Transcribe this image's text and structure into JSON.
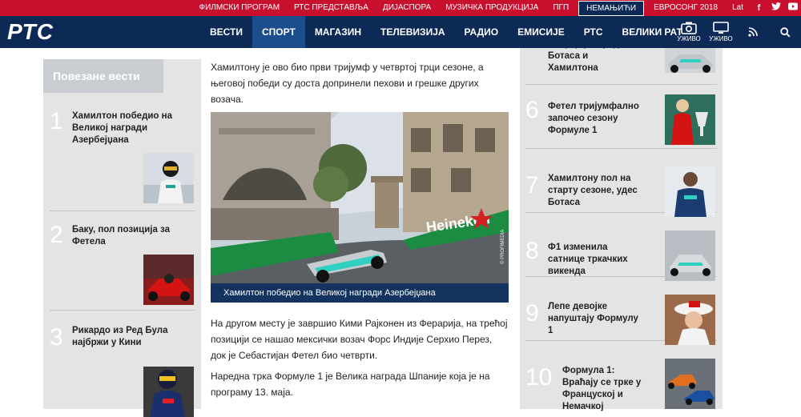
{
  "topbar": {
    "links": [
      "ФИЛМСКИ ПРОГРАМ",
      "РТС ПРЕДСТАВЉА",
      "ДИЈАСПОРА",
      "МУЗИЧКА ПРОДУКЦИЈА",
      "ПГП",
      "НЕМАЊИЋИ",
      "ЕВРОСОНГ 2018"
    ],
    "lang": "Lat",
    "social": [
      "facebook-icon",
      "twitter-icon",
      "youtube-icon"
    ]
  },
  "header": {
    "logo": "РТС",
    "nav": [
      "ВЕСТИ",
      "СПОРТ",
      "МАГАЗИН",
      "ТЕЛЕВИЗИЈА",
      "РАДИО",
      "ЕМИСИЈЕ",
      "РТС",
      "ВЕЛИКИ РАТ"
    ],
    "active_nav": "СПОРТ",
    "live_radio_label": "УЖИВО",
    "live_tv_label": "УЖИВО"
  },
  "related": {
    "heading": "Повезане вести",
    "items": [
      {
        "num": "1",
        "title": "Хамилтон победио на Великој награди Азербејџана"
      },
      {
        "num": "2",
        "title": "Баку, пол позиција за Фетела"
      },
      {
        "num": "3",
        "title": "Рикардо из Ред Була најбржи у Кини"
      }
    ]
  },
  "article": {
    "p1": "Хамилтону је ово био први тријумф у четвртој трци сезоне, а његовој победи су доста допринели пехови и грешке других возача.",
    "photo_caption": "Хамилтон победио на Великој награди Азербејџана",
    "photo_credit": "© PROFIMEDIA",
    "banner_text": "Heineken",
    "p2": "На другом месту је завршио Кими Рајконен из Ферарија, на трећој позицији се нашао мексички возач Форс Индије Серхио Перез, док је Себастијан Фетел био четврти.",
    "p3": "Наредна трка Формуле 1 је Велика награда Шпаније која је на програму 13. маја."
  },
  "popular": {
    "partial_top": "Бахрејну поред Ботаса и Хамилтона",
    "items": [
      {
        "num": "6",
        "title": "Фетел тријумфално започео сезону Формуле 1"
      },
      {
        "num": "7",
        "title": "Хамилтону пол на старту сезоне, удес Ботаса"
      },
      {
        "num": "8",
        "title": "Ф1 изменила сатнице тркачких викенда"
      },
      {
        "num": "9",
        "title": "Лепе девојке напуштају Формулу 1"
      },
      {
        "num": "10",
        "title": "Формула 1: Враћају се трке у Француској и Немачкој"
      }
    ]
  }
}
